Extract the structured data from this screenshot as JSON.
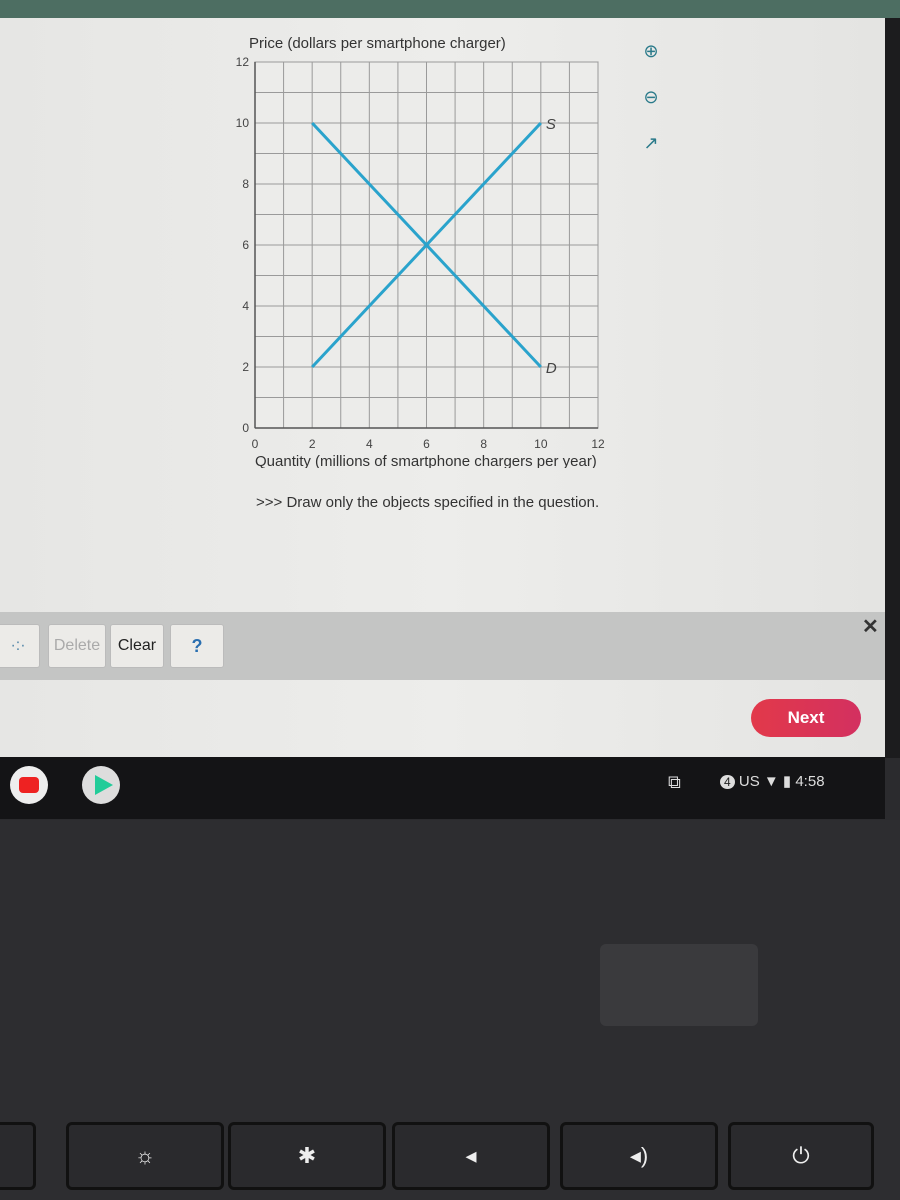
{
  "chart_data": {
    "type": "line",
    "ylabel": "Price (dollars per smartphone charger)",
    "xlabel": "Quantity (millions of smartphone chargers per year)",
    "xlim": [
      0,
      12
    ],
    "ylim": [
      0,
      12
    ],
    "xticks": [
      "0",
      "2",
      "4",
      "6",
      "8",
      "10",
      "12"
    ],
    "yticks": [
      "0",
      "2",
      "4",
      "6",
      "8",
      "10",
      "12"
    ],
    "grid": true,
    "series": [
      {
        "name": "D",
        "points": [
          [
            2,
            10
          ],
          [
            10,
            2
          ]
        ]
      },
      {
        "name": "S",
        "points": [
          [
            2,
            2
          ],
          [
            10,
            10
          ]
        ]
      }
    ],
    "line_color": "#2aa3cc"
  },
  "instruction": ">>> Draw only the objects specified in the question.",
  "side_tools": {
    "zoom_in": "zoom-in-icon",
    "zoom_out": "zoom-out-icon",
    "popout": "external-link-icon"
  },
  "toolbar": {
    "point_tool": "·:·",
    "delete": "Delete",
    "clear": "Clear",
    "help": "?",
    "close": "✕"
  },
  "next_label": "Next",
  "shelf": {
    "notif_count": "4",
    "keyboard": "US",
    "time": "4:58"
  }
}
